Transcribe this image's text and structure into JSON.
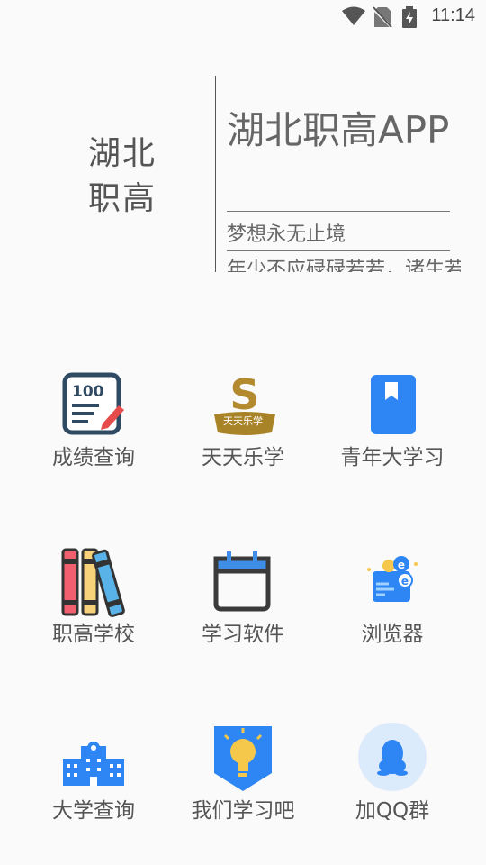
{
  "status_bar": {
    "time": "11:14"
  },
  "header": {
    "side_title": "湖北职高",
    "main_title": "湖北职高APP",
    "slogan1": "梦想永无止境",
    "slogan2": "年少不应碌碌若若，诸生若"
  },
  "grid": [
    {
      "label": "成绩查询",
      "icon": "grade-report-icon"
    },
    {
      "label": "天天乐学",
      "icon": "tiantian-lexue-logo",
      "logo_text": "天天乐学"
    },
    {
      "label": "青年大学习",
      "icon": "bookmark-icon"
    },
    {
      "label": "职高学校",
      "icon": "books-icon"
    },
    {
      "label": "学习软件",
      "icon": "calendar-icon"
    },
    {
      "label": "浏览器",
      "icon": "browser-icon"
    },
    {
      "label": "大学查询",
      "icon": "school-building-icon"
    },
    {
      "label": "我们学习吧",
      "icon": "lightbulb-badge-icon"
    },
    {
      "label": "加QQ群",
      "icon": "qq-icon"
    }
  ]
}
